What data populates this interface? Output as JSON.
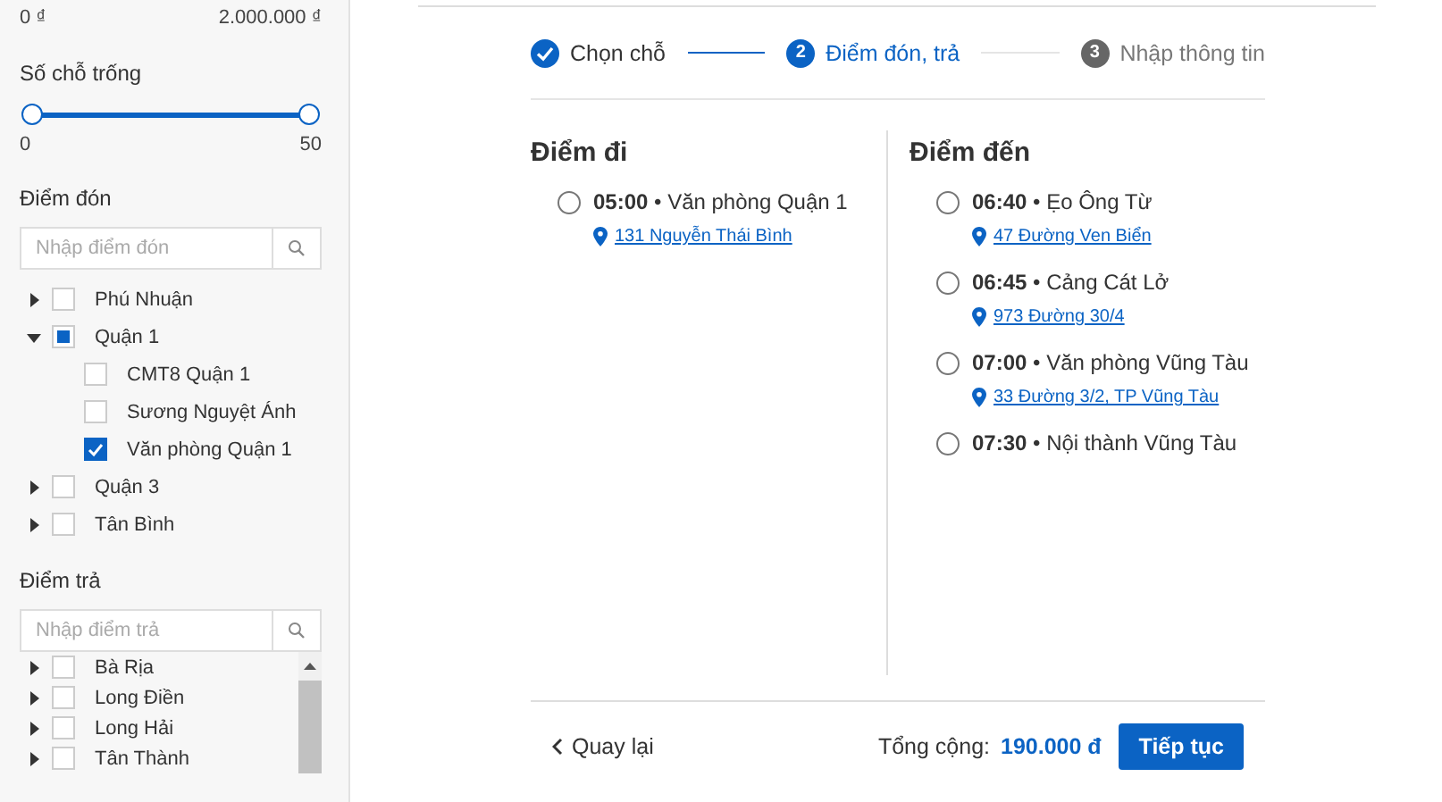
{
  "sidebar": {
    "price": {
      "min": "0 ₫",
      "max": "2.000.000 ₫"
    },
    "seats": {
      "title": "Số chỗ trống",
      "level": 1,
      "min": "0",
      "max": "50"
    },
    "pickup": {
      "title": "Điểm đón",
      "placeholder": "Nhập điểm đón",
      "items": [
        {
          "label": "Phú Nhuận",
          "expanded": false,
          "checked": false,
          "partial": false
        },
        {
          "label": "Quận 1",
          "expanded": true,
          "checked": false,
          "partial": true,
          "children": [
            {
              "label": "CMT8 Quận 1",
              "checked": false
            },
            {
              "label": "Sương Nguyệt Ánh",
              "checked": false
            },
            {
              "label": "Văn phòng Quận 1",
              "checked": true
            }
          ]
        },
        {
          "label": "Quận 3",
          "expanded": false,
          "checked": false,
          "partial": false
        },
        {
          "label": "Tân Bình",
          "expanded": false,
          "checked": false,
          "partial": false
        }
      ]
    },
    "dropoff": {
      "title": "Điểm trả",
      "placeholder": "Nhập điểm trả",
      "items": [
        {
          "label": "Bà Rịa",
          "expanded": false,
          "checked": false,
          "partial": false
        },
        {
          "label": "Long Điền",
          "expanded": false,
          "checked": false,
          "partial": false
        },
        {
          "label": "Long Hải",
          "expanded": false,
          "checked": false,
          "partial": false
        },
        {
          "label": "Tân Thành",
          "expanded": false,
          "checked": false,
          "partial": false
        }
      ]
    }
  },
  "steps": [
    {
      "label": "Chọn chỗ",
      "completed": true,
      "selected": false
    },
    {
      "number": "2",
      "label": "Điểm đón, trả",
      "completed": false,
      "selected": true
    },
    {
      "number": "3",
      "label": "Nhập thông tin",
      "completed": false,
      "selected": false
    }
  ],
  "columns": [
    {
      "title": "Điểm đi",
      "options": [
        {
          "text": "**05:00** • Văn phòng Quận 1",
          "address": "131 Nguyễn Thái Bình",
          "selected": false
        }
      ]
    },
    {
      "title": "Điểm đến",
      "options": [
        {
          "text": "**06:40** • Ẹo Ông Từ",
          "address": "47 Đường Ven Biển",
          "selected": false
        },
        {
          "text": "**06:45** • Cảng Cát Lở",
          "address": "973 Đường 30/4",
          "selected": false
        },
        {
          "text": "**07:00** • Văn phòng Vũng Tàu",
          "address": "33 Đường 3/2, TP Vũng Tàu",
          "selected": false
        },
        {
          "text": "**07:30** • Nội thành Vũng Tàu",
          "selected": false
        }
      ]
    }
  ],
  "footer": {
    "back": "Quay lại",
    "total_label": "Tổng cộng:",
    "total": "190.000 đ",
    "next": "Tiếp tục"
  }
}
